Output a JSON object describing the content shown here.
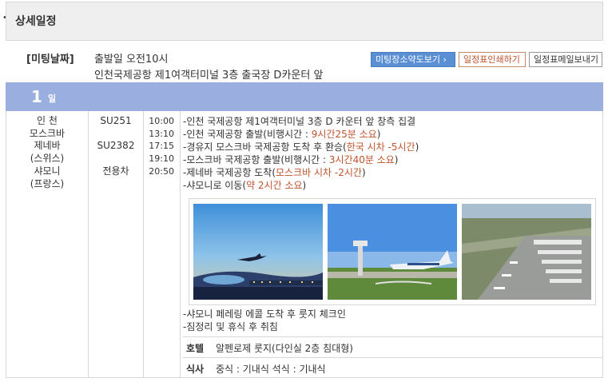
{
  "section": {
    "title": "상세일정"
  },
  "meeting": {
    "label": "[미팅날짜]",
    "line1": "출발일 오전10시",
    "line2": "인천국제공항 제1여객터미널 3층 출국장 D카운터 앞"
  },
  "buttons": {
    "map": "미팅장소약도보기 ›",
    "print": "일정표인쇄하기",
    "mail": "일정표메일보내기"
  },
  "day": {
    "number": "1",
    "unit": "일"
  },
  "cities": [
    "인 천",
    "모스크바",
    "제네바",
    "(스위스)",
    "샤모니",
    "(프랑스)"
  ],
  "flights": [
    "",
    "SU251",
    "",
    "SU2382",
    "",
    "전용차"
  ],
  "times": [
    "10:00",
    "13:10",
    "17:15",
    "19:10",
    "20:50"
  ],
  "events": [
    {
      "text": "-인천 국제공항 제1여객터미널 3층 D 카운터 앞 창측 집결",
      "hl": "",
      "tail": ""
    },
    {
      "text": "-인천 국제공항 출발(비행시간 : ",
      "hl": "9시간25분 소요",
      "tail": ")"
    },
    {
      "text": "-경유지 모스크바 국제공항 도착 후 환승(",
      "hl": "한국 시차 -5시간",
      "tail": ")"
    },
    {
      "text": "-모스크바 국제공항 출발(비행시간 : ",
      "hl": "3시간40분 소요",
      "tail": ")"
    },
    {
      "text": "-제네바 국제공항 도착(",
      "hl": "모스크바 시차 -2시간",
      "tail": ")"
    },
    {
      "text": "-샤모니로 이동(",
      "hl": "약 2시간 소요",
      "tail": ")"
    }
  ],
  "events2": [
    "-샤모니 페레링 에콜 도착 후 룻지 체크인",
    "-짐정리 및 휴식 후 취침"
  ],
  "hotel": {
    "label": "호텔",
    "value": "알펜로제 룻지(다인실 2층 침대형)"
  },
  "meal": {
    "label": "식사",
    "value": "중식 : 기내식   석식 : 기내식"
  },
  "colors": {
    "day_bar": "#9aaee0",
    "highlight": "#c0532c",
    "map_button": "#5b8fd4"
  }
}
